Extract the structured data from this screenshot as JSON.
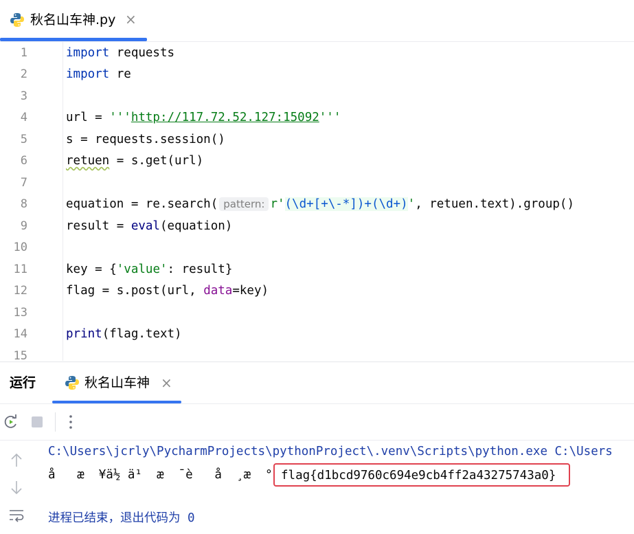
{
  "editor_tab": {
    "title": "秋名山车神.py",
    "close": "×"
  },
  "code": {
    "lines": [
      "1",
      "2",
      "3",
      "4",
      "5",
      "6",
      "7",
      "8",
      "9",
      "10",
      "11",
      "12",
      "13",
      "14",
      "15"
    ],
    "l1_kw": "import",
    "l1_rest": " requests",
    "l2_kw": "import",
    "l2_rest": " re",
    "l4_a": "url = ",
    "l4_q1": "'''",
    "l4_url": "http://117.72.52.127:15092",
    "l4_q2": "'''",
    "l5": "s = requests.session()",
    "l6_var": "retuen",
    "l6_rest": " = s.get(url)",
    "l8_a": "equation = re.search(",
    "l8_hint": "pattern:",
    "l8_r": "r'",
    "l8_regex1": "(\\d+[+\\-*])+(\\d+)",
    "l8_q": "'",
    "l8_b": ", retuen.text).group()",
    "l9_a": "result = ",
    "l9_eval": "eval",
    "l9_b": "(equation)",
    "l11_a": "key = {",
    "l11_str": "'value'",
    "l11_b": ": result}",
    "l12_a": "flag = s.post(url, ",
    "l12_param": "data",
    "l12_b": "=key)",
    "l14_print": "print",
    "l14_b": "(flag.text)"
  },
  "run_panel": {
    "label": "运行",
    "tab_title": "秋名山车神",
    "close": "×"
  },
  "console": {
    "cmd": "C:\\Users\\jcrly\\PycharmProjects\\pythonProject\\.venv\\Scripts\\python.exe C:\\Users",
    "garbled": "å   æ  ¥ä½ ä¹  æ  ¯è   å  ¸æ  °",
    "flag": "flag{d1bcd9760c694e9cb4ff2a43275743a0}",
    "exit": "进程已结束，退出代码为 0"
  },
  "icons": {
    "python": "python-icon",
    "rerun": "rerun-icon",
    "stop": "stop-icon",
    "more": "more-vertical-icon",
    "up": "arrow-up-icon",
    "down": "arrow-down-icon",
    "wrap": "soft-wrap-icon"
  },
  "colors": {
    "accent": "#3574f0",
    "keyword": "#0033b3",
    "string": "#067d17",
    "highlight": "#e0424f"
  }
}
